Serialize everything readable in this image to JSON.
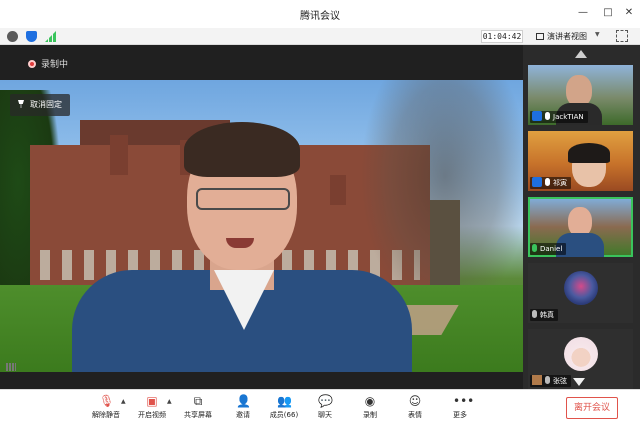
{
  "window": {
    "title": "腾讯会议",
    "controls": {
      "minimize": "—",
      "maximize": "□",
      "close": "✕"
    }
  },
  "infobar": {
    "timer": "01:04:42",
    "view_label": "演讲者视图"
  },
  "stage": {
    "recording_text": "录制中",
    "unpin_label": "取消固定"
  },
  "participants": [
    {
      "name": "JackTIAN",
      "host": true,
      "mic": "normal"
    },
    {
      "name": "祁寅",
      "host": true,
      "mic": "normal"
    },
    {
      "name": "Daniel",
      "host": false,
      "mic": "active"
    },
    {
      "name": "韩真",
      "host": false,
      "mic": "muted"
    },
    {
      "name": "张弦",
      "host": false,
      "mic": "muted"
    }
  ],
  "toolbar": {
    "unmute": "解除静音",
    "start_video": "开启视频",
    "share_screen": "共享屏幕",
    "invite": "邀请",
    "members": "成员(66)",
    "chat": "聊天",
    "record": "录制",
    "reactions": "表情",
    "more": "更多",
    "leave": "离开会议"
  },
  "colors": {
    "leave_red": "#e0534b",
    "host_blue": "#1e6fe0",
    "speaking_green": "#3ac45c",
    "record_red": "#e03c3c"
  }
}
